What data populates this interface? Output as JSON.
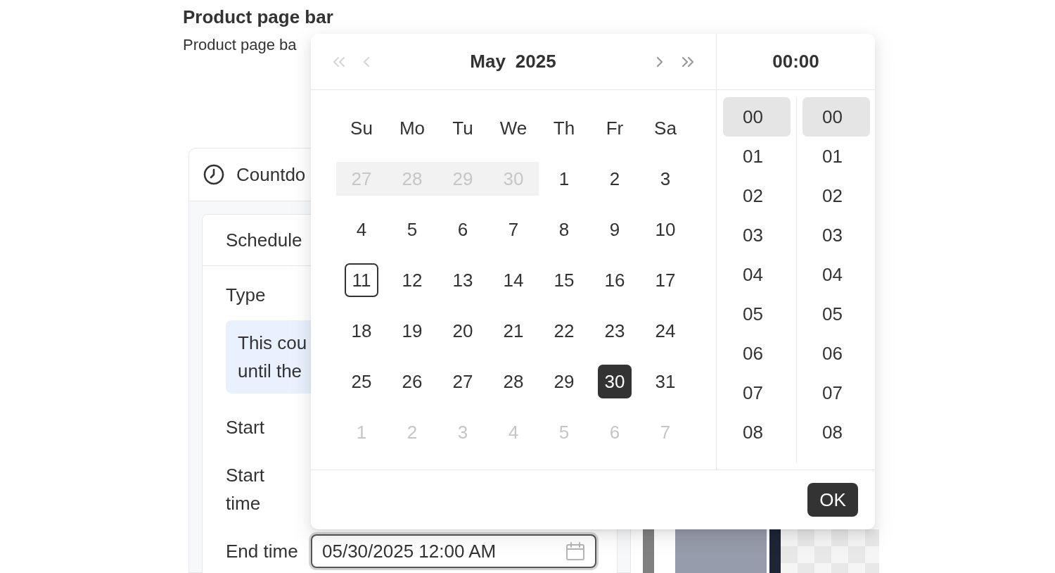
{
  "header": {
    "title": "Product page bar",
    "subtitle": "Product page ba"
  },
  "card": {
    "title": "Countdo",
    "section": {
      "title": "Schedule",
      "type_label": "Type",
      "info_lines": [
        "This cou",
        "until the"
      ],
      "rows": [
        {
          "kind": "label",
          "label": "Start"
        },
        {
          "kind": "label",
          "label": "Start time"
        },
        {
          "kind": "datetime",
          "label": "End time",
          "value": "05/30/2025 12:00 AM",
          "focused": true
        }
      ]
    }
  },
  "date_picker": {
    "month": "May",
    "year": "2025",
    "nav": [
      {
        "kind": "prev_year",
        "disabled": true
      },
      {
        "kind": "prev_month",
        "disabled": true
      },
      {
        "kind": "next_month",
        "disabled": false
      },
      {
        "kind": "next_year",
        "disabled": false
      }
    ],
    "weekdays": [
      "Su",
      "Mo",
      "Tu",
      "We",
      "Th",
      "Fr",
      "Sa"
    ],
    "weeks": [
      [
        {
          "label": "27",
          "outside": true,
          "disabled": true,
          "today": false,
          "selected": false
        },
        {
          "label": "28",
          "outside": true,
          "disabled": true,
          "today": false,
          "selected": false
        },
        {
          "label": "29",
          "outside": true,
          "disabled": true,
          "today": false,
          "selected": false
        },
        {
          "label": "30",
          "outside": true,
          "disabled": true,
          "today": false,
          "selected": false
        },
        {
          "label": "1",
          "outside": false,
          "disabled": false,
          "today": false,
          "selected": false
        },
        {
          "label": "2",
          "outside": false,
          "disabled": false,
          "today": false,
          "selected": false
        },
        {
          "label": "3",
          "outside": false,
          "disabled": false,
          "today": false,
          "selected": false
        }
      ],
      [
        {
          "label": "4",
          "outside": false,
          "disabled": false,
          "today": false,
          "selected": false
        },
        {
          "label": "5",
          "outside": false,
          "disabled": false,
          "today": false,
          "selected": false
        },
        {
          "label": "6",
          "outside": false,
          "disabled": false,
          "today": false,
          "selected": false
        },
        {
          "label": "7",
          "outside": false,
          "disabled": false,
          "today": false,
          "selected": false
        },
        {
          "label": "8",
          "outside": false,
          "disabled": false,
          "today": false,
          "selected": false
        },
        {
          "label": "9",
          "outside": false,
          "disabled": false,
          "today": false,
          "selected": false
        },
        {
          "label": "10",
          "outside": false,
          "disabled": false,
          "today": false,
          "selected": false
        }
      ],
      [
        {
          "label": "11",
          "outside": false,
          "disabled": false,
          "today": true,
          "selected": false
        },
        {
          "label": "12",
          "outside": false,
          "disabled": false,
          "today": false,
          "selected": false
        },
        {
          "label": "13",
          "outside": false,
          "disabled": false,
          "today": false,
          "selected": false
        },
        {
          "label": "14",
          "outside": false,
          "disabled": false,
          "today": false,
          "selected": false
        },
        {
          "label": "15",
          "outside": false,
          "disabled": false,
          "today": false,
          "selected": false
        },
        {
          "label": "16",
          "outside": false,
          "disabled": false,
          "today": false,
          "selected": false
        },
        {
          "label": "17",
          "outside": false,
          "disabled": false,
          "today": false,
          "selected": false
        }
      ],
      [
        {
          "label": "18",
          "outside": false,
          "disabled": false,
          "today": false,
          "selected": false
        },
        {
          "label": "19",
          "outside": false,
          "disabled": false,
          "today": false,
          "selected": false
        },
        {
          "label": "20",
          "outside": false,
          "disabled": false,
          "today": false,
          "selected": false
        },
        {
          "label": "21",
          "outside": false,
          "disabled": false,
          "today": false,
          "selected": false
        },
        {
          "label": "22",
          "outside": false,
          "disabled": false,
          "today": false,
          "selected": false
        },
        {
          "label": "23",
          "outside": false,
          "disabled": false,
          "today": false,
          "selected": false
        },
        {
          "label": "24",
          "outside": false,
          "disabled": false,
          "today": false,
          "selected": false
        }
      ],
      [
        {
          "label": "25",
          "outside": false,
          "disabled": false,
          "today": false,
          "selected": false
        },
        {
          "label": "26",
          "outside": false,
          "disabled": false,
          "today": false,
          "selected": false
        },
        {
          "label": "27",
          "outside": false,
          "disabled": false,
          "today": false,
          "selected": false
        },
        {
          "label": "28",
          "outside": false,
          "disabled": false,
          "today": false,
          "selected": false
        },
        {
          "label": "29",
          "outside": false,
          "disabled": false,
          "today": false,
          "selected": false
        },
        {
          "label": "30",
          "outside": false,
          "disabled": false,
          "today": false,
          "selected": true
        },
        {
          "label": "31",
          "outside": false,
          "disabled": false,
          "today": false,
          "selected": false
        }
      ],
      [
        {
          "label": "1",
          "outside": true,
          "disabled": false,
          "today": false,
          "selected": false
        },
        {
          "label": "2",
          "outside": true,
          "disabled": false,
          "today": false,
          "selected": false
        },
        {
          "label": "3",
          "outside": true,
          "disabled": false,
          "today": false,
          "selected": false
        },
        {
          "label": "4",
          "outside": true,
          "disabled": false,
          "today": false,
          "selected": false
        },
        {
          "label": "5",
          "outside": true,
          "disabled": false,
          "today": false,
          "selected": false
        },
        {
          "label": "6",
          "outside": true,
          "disabled": false,
          "today": false,
          "selected": false
        },
        {
          "label": "7",
          "outside": true,
          "disabled": false,
          "today": false,
          "selected": false
        }
      ]
    ],
    "time": {
      "display": "00:00",
      "hours": [
        {
          "label": "00",
          "selected": true
        },
        {
          "label": "01",
          "selected": false
        },
        {
          "label": "02",
          "selected": false
        },
        {
          "label": "03",
          "selected": false
        },
        {
          "label": "04",
          "selected": false
        },
        {
          "label": "05",
          "selected": false
        },
        {
          "label": "06",
          "selected": false
        },
        {
          "label": "07",
          "selected": false
        },
        {
          "label": "08",
          "selected": false
        }
      ],
      "minutes": [
        {
          "label": "00",
          "selected": true
        },
        {
          "label": "01",
          "selected": false
        },
        {
          "label": "02",
          "selected": false
        },
        {
          "label": "03",
          "selected": false
        },
        {
          "label": "04",
          "selected": false
        },
        {
          "label": "05",
          "selected": false
        },
        {
          "label": "06",
          "selected": false
        },
        {
          "label": "07",
          "selected": false
        },
        {
          "label": "08",
          "selected": false
        }
      ]
    },
    "ok_button": "OK"
  }
}
